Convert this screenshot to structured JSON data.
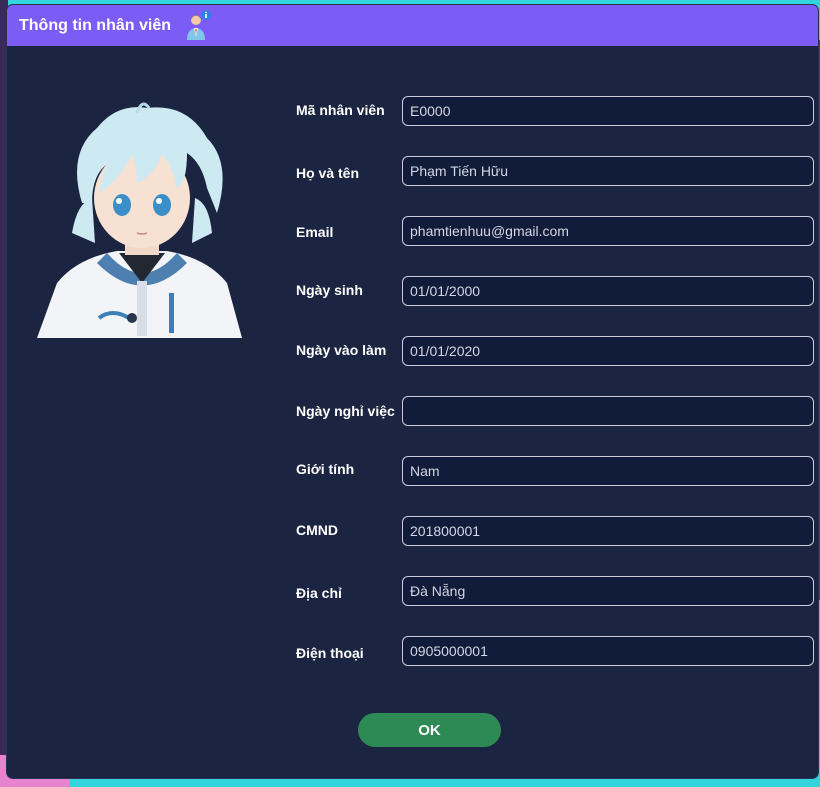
{
  "dialog": {
    "title": "Thông tin nhân viên",
    "title_icon": "employee-info-icon",
    "ok_label": "OK"
  },
  "fields": [
    {
      "label": "Mã nhân viên",
      "value": "E0000"
    },
    {
      "label": "Họ và tên",
      "value": "Phạm Tiến Hữu"
    },
    {
      "label": "Email",
      "value": "phamtienhuu@gmail.com"
    },
    {
      "label": "Ngày sinh",
      "value": "01/01/2000"
    },
    {
      "label": "Ngày vào làm",
      "value": "01/01/2020"
    },
    {
      "label": "Ngày nghỉ việc",
      "value": ""
    },
    {
      "label": "Giới tính",
      "value": "Nam"
    },
    {
      "label": "CMND",
      "value": "201800001"
    },
    {
      "label": "Địa chỉ",
      "value": "Đà Nẵng"
    },
    {
      "label": "Điện thoại",
      "value": "0905000001"
    }
  ],
  "colors": {
    "titlebar": "#7b5cf5",
    "dialog_bg": "#1b2541",
    "field_bg": "#111c3a",
    "ok_button": "#2e8a55"
  }
}
